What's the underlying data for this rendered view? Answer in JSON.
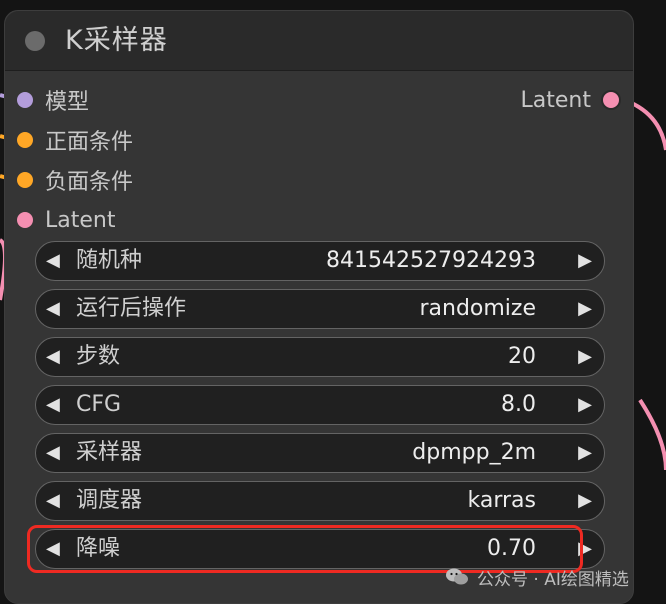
{
  "node": {
    "title": "K采样器"
  },
  "inputs": [
    {
      "label": "模型",
      "color": "#b39ddb"
    },
    {
      "label": "正面条件",
      "color": "#ffa726"
    },
    {
      "label": "负面条件",
      "color": "#ffa726"
    },
    {
      "label": "Latent",
      "color": "#f48fb1"
    }
  ],
  "outputs": [
    {
      "label": "Latent",
      "color": "#f48fb1"
    }
  ],
  "widgets": [
    {
      "label": "随机种",
      "value": "841542527924293"
    },
    {
      "label": "运行后操作",
      "value": "randomize"
    },
    {
      "label": "步数",
      "value": "20"
    },
    {
      "label": "CFG",
      "value": "8.0"
    },
    {
      "label": "采样器",
      "value": "dpmpp_2m"
    },
    {
      "label": "调度器",
      "value": "karras"
    },
    {
      "label": "降噪",
      "value": "0.70"
    }
  ],
  "arrows": {
    "left": "◀",
    "right": "▶"
  },
  "watermark": {
    "text": "公众号 · AI绘图精选"
  },
  "colors": {
    "highlight": "#ef2a22",
    "node_bg": "#353535",
    "wire_pink": "#f48fb1",
    "wire_orange": "#ffa726"
  }
}
